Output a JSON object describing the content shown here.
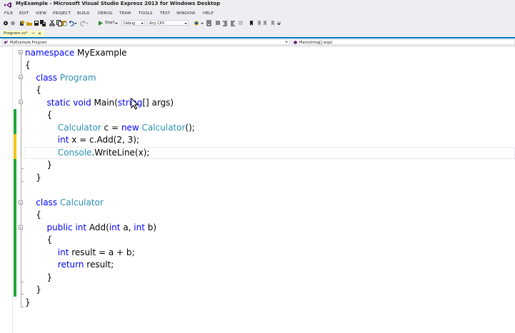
{
  "window": {
    "title": "MyExample - Microsoft Visual Studio Express 2013 for Windows Desktop"
  },
  "menu": [
    "FILE",
    "EDIT",
    "VIEW",
    "PROJECT",
    "BUILD",
    "DEBUG",
    "TEAM",
    "TOOLS",
    "TEST",
    "WINDOW",
    "HELP"
  ],
  "toolbar": {
    "start_label": "Start",
    "config": "Debug",
    "platform": "Any CPU"
  },
  "tab": {
    "label": "Program.cs*",
    "pin": "→",
    "close": "×"
  },
  "nav": {
    "left": "MyExample.Program",
    "right": "Main(string[] args)"
  },
  "colors": {
    "keyword": "#0000ff",
    "type": "#2b91af",
    "saved_change": "#1fa83d",
    "unsaved_change": "#f3c612",
    "accent": "#007acc",
    "tab_bg": "#fefcc8"
  },
  "code": [
    {
      "tokens": [
        {
          "k": "kw",
          "t": "namespace"
        },
        {
          "t": " MyExample"
        }
      ]
    },
    {
      "tokens": [
        {
          "t": "{"
        }
      ]
    },
    {
      "tokens": [
        {
          "t": "    "
        },
        {
          "k": "kw",
          "t": "class"
        },
        {
          "t": " "
        },
        {
          "k": "ty",
          "t": "Program"
        }
      ]
    },
    {
      "tokens": [
        {
          "t": "    {"
        }
      ]
    },
    {
      "tokens": [
        {
          "t": "        "
        },
        {
          "k": "kw",
          "t": "static"
        },
        {
          "t": " "
        },
        {
          "k": "kw",
          "t": "void"
        },
        {
          "t": " Main("
        },
        {
          "k": "kw",
          "t": "string"
        },
        {
          "t": "[] args)"
        }
      ]
    },
    {
      "tokens": [
        {
          "t": "        {"
        }
      ]
    },
    {
      "tokens": [
        {
          "t": "            "
        },
        {
          "k": "ty",
          "t": "Calculator"
        },
        {
          "t": " c = "
        },
        {
          "k": "kw",
          "t": "new"
        },
        {
          "t": " "
        },
        {
          "k": "ty",
          "t": "Calculator"
        },
        {
          "t": "();"
        }
      ]
    },
    {
      "tokens": [
        {
          "t": "            "
        },
        {
          "k": "kw",
          "t": "int"
        },
        {
          "t": " x = c.Add(2, 3);"
        }
      ]
    },
    {
      "tokens": [
        {
          "t": "            "
        },
        {
          "k": "ty",
          "t": "Console"
        },
        {
          "t": ".WriteLine(x);"
        }
      ]
    },
    {
      "tokens": [
        {
          "t": "        }"
        }
      ]
    },
    {
      "tokens": [
        {
          "t": "    }"
        }
      ]
    },
    {
      "tokens": []
    },
    {
      "tokens": [
        {
          "t": "    "
        },
        {
          "k": "kw",
          "t": "class"
        },
        {
          "t": " "
        },
        {
          "k": "ty",
          "t": "Calculator"
        }
      ]
    },
    {
      "tokens": [
        {
          "t": "    {"
        }
      ]
    },
    {
      "tokens": [
        {
          "t": "        "
        },
        {
          "k": "kw",
          "t": "public"
        },
        {
          "t": " "
        },
        {
          "k": "kw",
          "t": "int"
        },
        {
          "t": " Add("
        },
        {
          "k": "kw",
          "t": "int"
        },
        {
          "t": " a, "
        },
        {
          "k": "kw",
          "t": "int"
        },
        {
          "t": " b)"
        }
      ]
    },
    {
      "tokens": [
        {
          "t": "        {"
        }
      ]
    },
    {
      "tokens": [
        {
          "t": "            "
        },
        {
          "k": "kw",
          "t": "int"
        },
        {
          "t": " result = a + b;"
        }
      ]
    },
    {
      "tokens": [
        {
          "t": "            "
        },
        {
          "k": "kw",
          "t": "return"
        },
        {
          "t": " result;"
        }
      ]
    },
    {
      "tokens": [
        {
          "t": "        }"
        }
      ]
    },
    {
      "tokens": [
        {
          "t": "    }"
        }
      ]
    },
    {
      "tokens": [
        {
          "t": "}"
        }
      ]
    }
  ]
}
